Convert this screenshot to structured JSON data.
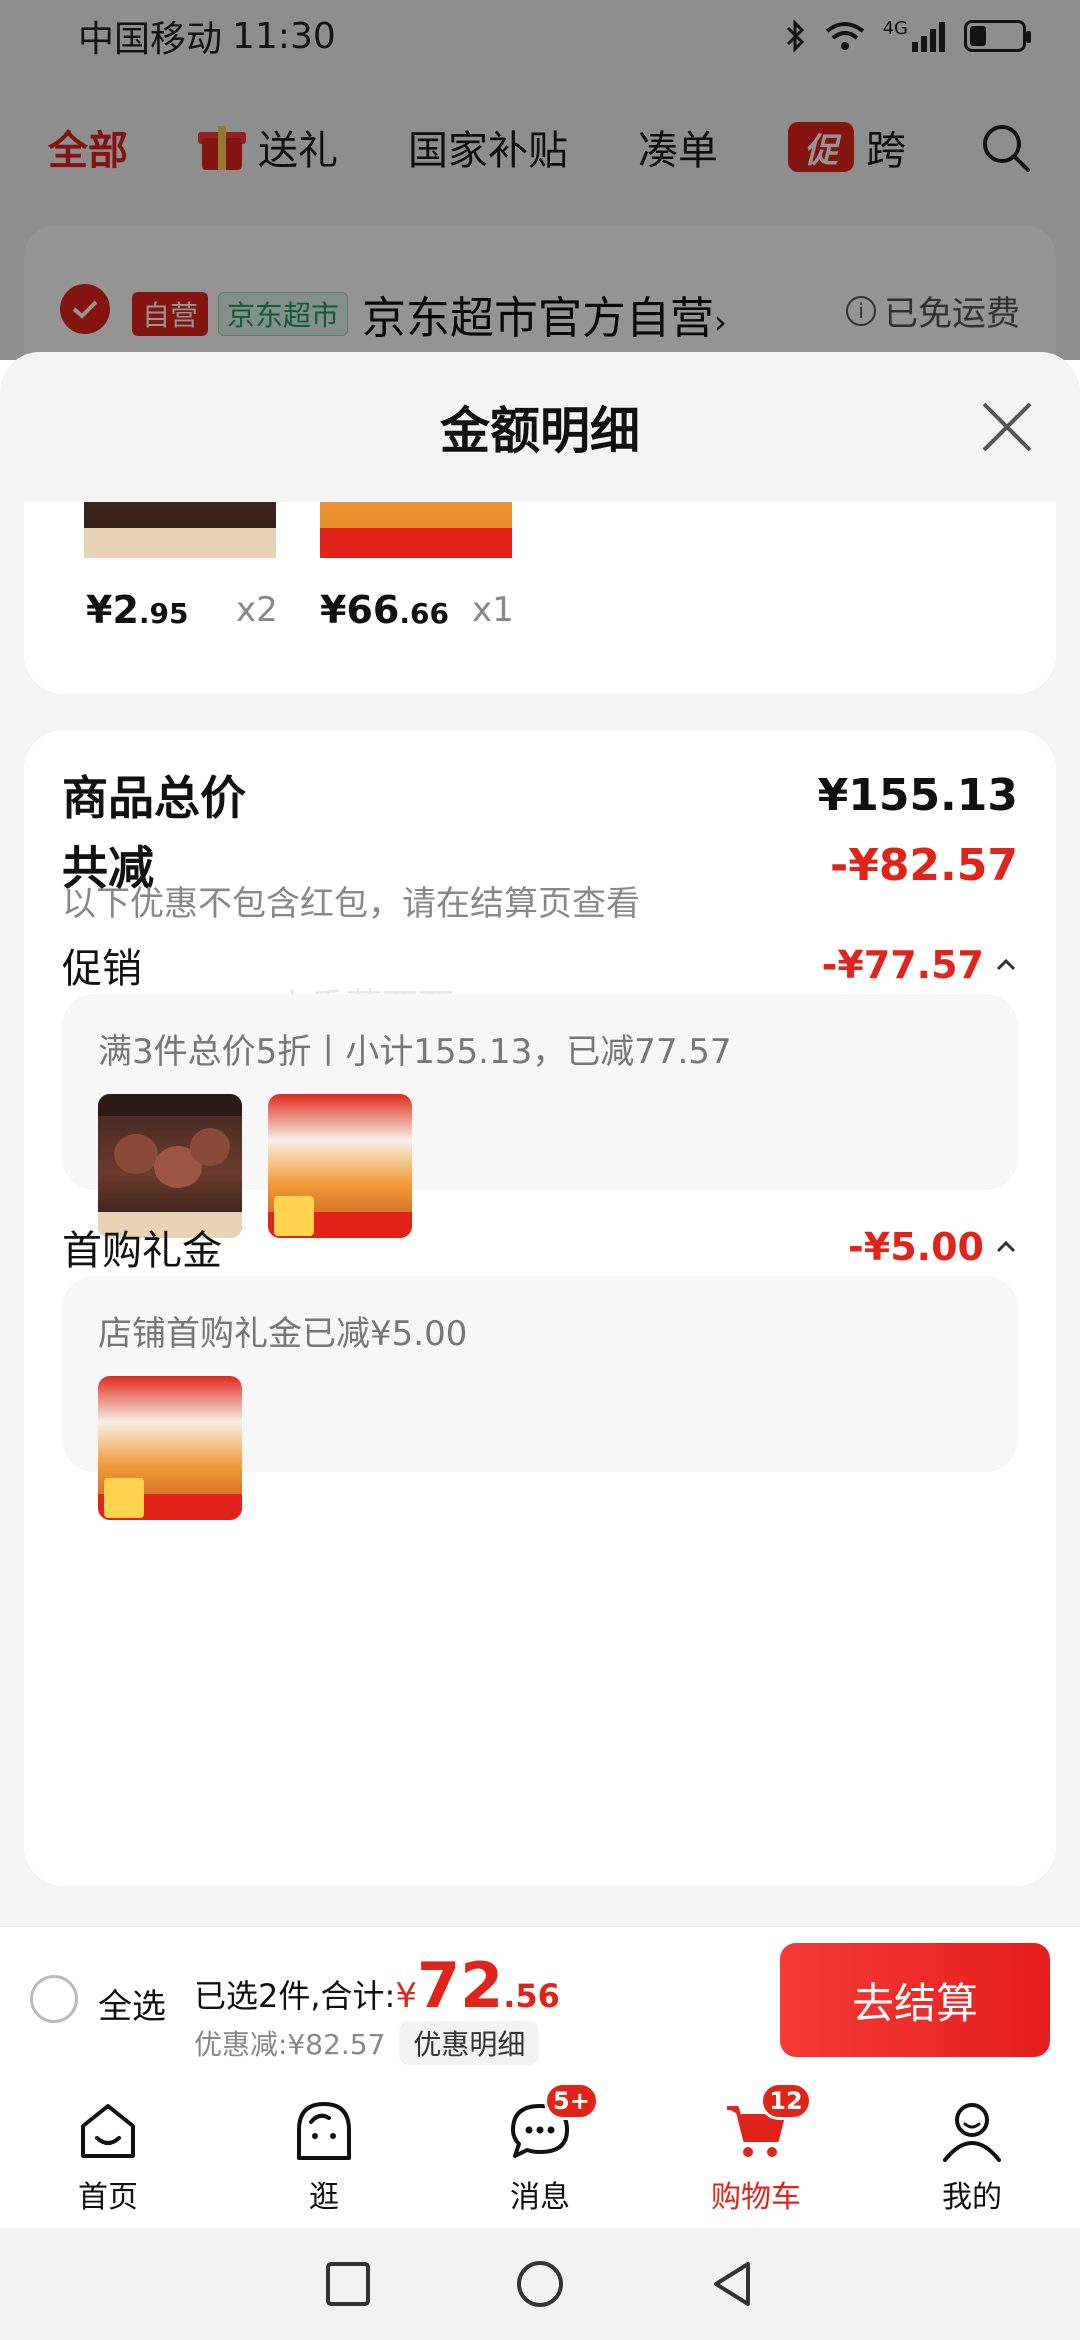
{
  "status_bar": {
    "carrier": "中国移动",
    "time": "11:30",
    "network": "4G"
  },
  "top_tabs": [
    {
      "label": "全部",
      "active": true
    },
    {
      "label": "送礼",
      "icon": "gift-icon"
    },
    {
      "label": "国家补贴"
    },
    {
      "label": "凑单"
    },
    {
      "label": "跨",
      "badge": "促"
    }
  ],
  "shop": {
    "tag_self": "自营",
    "tag_market": "京东超市",
    "name": "京东超市官方自营",
    "chevron": "›",
    "shipping": "已免运费",
    "info_glyph": "i"
  },
  "sheet": {
    "title": "金额明细"
  },
  "products": [
    {
      "price_int": "¥2",
      "price_dec": ".95",
      "qty": "x2"
    },
    {
      "price_int": "¥66",
      "price_dec": ".66",
      "qty": "x1"
    }
  ],
  "summary": {
    "total_label": "商品总价",
    "total_value": "¥155.13",
    "reduce_label": "共减",
    "reduce_value": "-¥82.57",
    "reduce_note": "以下优惠不包含红包，请在结算页查看",
    "promo_label": "促销",
    "promo_value": "-¥77.57",
    "promo_detail": "满3件总价5折丨小计155.13，已减77.57",
    "gift_label": "首购礼金",
    "gift_value": "-¥5.00",
    "gift_detail": "店铺首购礼金已减¥5.00",
    "watermark": "小香菜西西"
  },
  "checkout": {
    "select_all": "全选",
    "selected_text": "已选2件,合计:",
    "currency": "¥",
    "total_int": "72",
    "total_dec": ".56",
    "discount_text": "优惠减:¥82.57",
    "discount_detail_btn": "优惠明细",
    "checkout_btn": "去结算"
  },
  "bottom_nav": [
    {
      "label": "首页",
      "icon": "home-icon"
    },
    {
      "label": "逛",
      "icon": "explore-icon"
    },
    {
      "label": "消息",
      "icon": "message-icon",
      "badge": "5+"
    },
    {
      "label": "购物车",
      "icon": "cart-icon",
      "badge": "12",
      "active": true
    },
    {
      "label": "我的",
      "icon": "profile-icon"
    }
  ],
  "colors": {
    "accent": "#e2231a",
    "green": "#1ba35a",
    "sheet_bg": "#f4f4f4"
  }
}
